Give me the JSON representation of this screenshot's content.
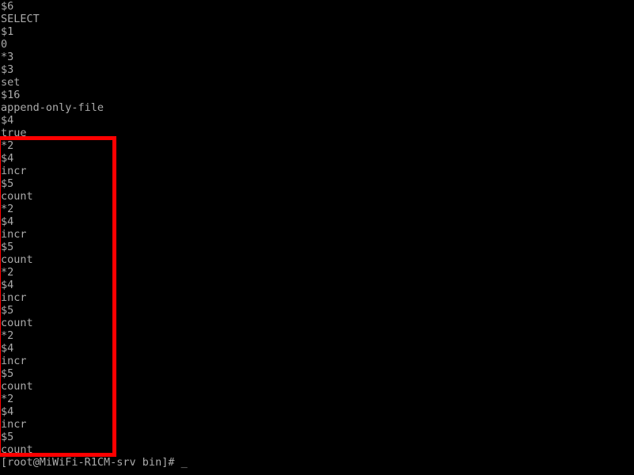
{
  "terminal": {
    "background_color": "#000000",
    "text_color": "#aaaaaa",
    "highlight_color": "#ff0000",
    "output_lines": [
      "$6",
      "SELECT",
      "$1",
      "0",
      "*3",
      "$3",
      "set",
      "$16",
      "append-only-file",
      "$4",
      "true",
      "*2",
      "$4",
      "incr",
      "$5",
      "count",
      "*2",
      "$4",
      "incr",
      "$5",
      "count",
      "*2",
      "$4",
      "incr",
      "$5",
      "count",
      "*2",
      "$4",
      "incr",
      "$5",
      "count",
      "*2",
      "$4",
      "incr",
      "$5",
      "count"
    ],
    "prompt": {
      "text": "[root@MiWiFi-R1CM-srv bin]# ",
      "user": "root",
      "host": "MiWiFi-R1CM-srv",
      "directory": "bin",
      "symbol": "#",
      "cursor": "_"
    },
    "highlight_region": {
      "label": "repeated-incr-count-commands",
      "first_line_index": 11,
      "last_line_index": 35,
      "line_count": 25
    }
  }
}
